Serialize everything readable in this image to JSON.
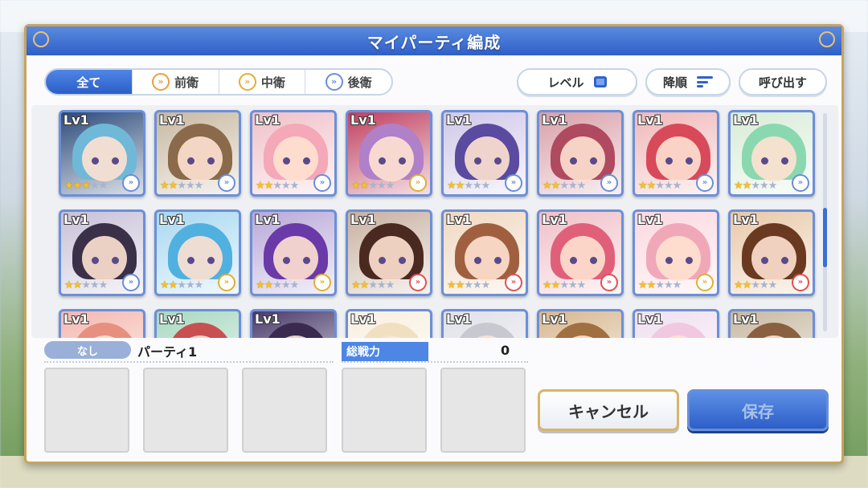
{
  "dialog": {
    "title": "マイパーティ編成"
  },
  "filter_tabs": [
    {
      "label": "全て",
      "icon": null
    },
    {
      "label": "前衛",
      "icon": "front-position-icon"
    },
    {
      "label": "中衛",
      "icon": "middle-position-icon"
    },
    {
      "label": "後衛",
      "icon": "back-position-icon"
    }
  ],
  "toolbar": {
    "level_label": "レベル",
    "order_label": "降順",
    "recall_label": "呼び出す"
  },
  "characters": [
    {
      "level": "Lv1",
      "stars": 3,
      "position": "back",
      "bg": "#2c4a7a",
      "hair": "#6fb8d8"
    },
    {
      "level": "Lv1",
      "stars": 2,
      "position": "back",
      "bg": "#c8b8a0",
      "hair": "#8a6a4a"
    },
    {
      "level": "Lv1",
      "stars": 2,
      "position": "back",
      "bg": "#f0c0c8",
      "hair": "#f4a8b8"
    },
    {
      "level": "Lv1",
      "stars": 2,
      "position": "mid",
      "bg": "#c04060",
      "hair": "#b080c8"
    },
    {
      "level": "Lv1",
      "stars": 2,
      "position": "back",
      "bg": "#d0c8e8",
      "hair": "#5a4aa0"
    },
    {
      "level": "Lv1",
      "stars": 2,
      "position": "back",
      "bg": "#d8a0a8",
      "hair": "#b04a60"
    },
    {
      "level": "Lv1",
      "stars": 2,
      "position": "back",
      "bg": "#f0b8b8",
      "hair": "#d84a5a"
    },
    {
      "level": "Lv1",
      "stars": 2,
      "position": "back",
      "bg": "#d8ecd8",
      "hair": "#8ad8b0"
    },
    {
      "level": "Lv1",
      "stars": 2,
      "position": "back",
      "bg": "#c8c0d8",
      "hair": "#3a3048"
    },
    {
      "level": "Lv1",
      "stars": 2,
      "position": "mid",
      "bg": "#a8d8f0",
      "hair": "#50b0e0"
    },
    {
      "level": "Lv1",
      "stars": 2,
      "position": "mid",
      "bg": "#b8a8d8",
      "hair": "#6a3aa8"
    },
    {
      "level": "Lv1",
      "stars": 2,
      "position": "red",
      "bg": "#c8b0a0",
      "hair": "#4a2a20"
    },
    {
      "level": "Lv1",
      "stars": 2,
      "position": "red",
      "bg": "#f0d8c0",
      "hair": "#a06040"
    },
    {
      "level": "Lv1",
      "stars": 2,
      "position": "red",
      "bg": "#f0c0c8",
      "hair": "#e0607a"
    },
    {
      "level": "Lv1",
      "stars": 2,
      "position": "mid",
      "bg": "#fcd8e0",
      "hair": "#f0a8b8"
    },
    {
      "level": "Lv1",
      "stars": 2,
      "position": "red",
      "bg": "#e8c8a8",
      "hair": "#6a3a20"
    },
    {
      "level": "Lv1",
      "stars": 0,
      "position": "back",
      "bg": "#f4b8b0",
      "hair": "#e89080"
    },
    {
      "level": "Lv1",
      "stars": 0,
      "position": "back",
      "bg": "#a8d8c0",
      "hair": "#c85050"
    },
    {
      "level": "Lv1",
      "stars": 0,
      "position": "back",
      "bg": "#4a3a6a",
      "hair": "#3a2a50"
    },
    {
      "level": "Lv1",
      "stars": 0,
      "position": "back",
      "bg": "#f8f0e0",
      "hair": "#f0e0c0"
    },
    {
      "level": "Lv1",
      "stars": 0,
      "position": "back",
      "bg": "#e0e0e8",
      "hair": "#c8c8d0"
    },
    {
      "level": "Lv1",
      "stars": 0,
      "position": "back",
      "bg": "#d8b890",
      "hair": "#a07040"
    },
    {
      "level": "Lv1",
      "stars": 0,
      "position": "back",
      "bg": "#f0e0f0",
      "hair": "#f0c8e0"
    },
    {
      "level": "Lv1",
      "stars": 0,
      "position": "back",
      "bg": "#c8b8a0",
      "hair": "#8a6040"
    }
  ],
  "party": {
    "badge": "なし",
    "name": "パーティ1",
    "power_label": "総戦力",
    "power_value": "0"
  },
  "actions": {
    "cancel_label": "キャンセル",
    "save_label": "保存"
  },
  "colors": {
    "accent": "#2f5fc7",
    "frame_gold": "#caa35a"
  }
}
